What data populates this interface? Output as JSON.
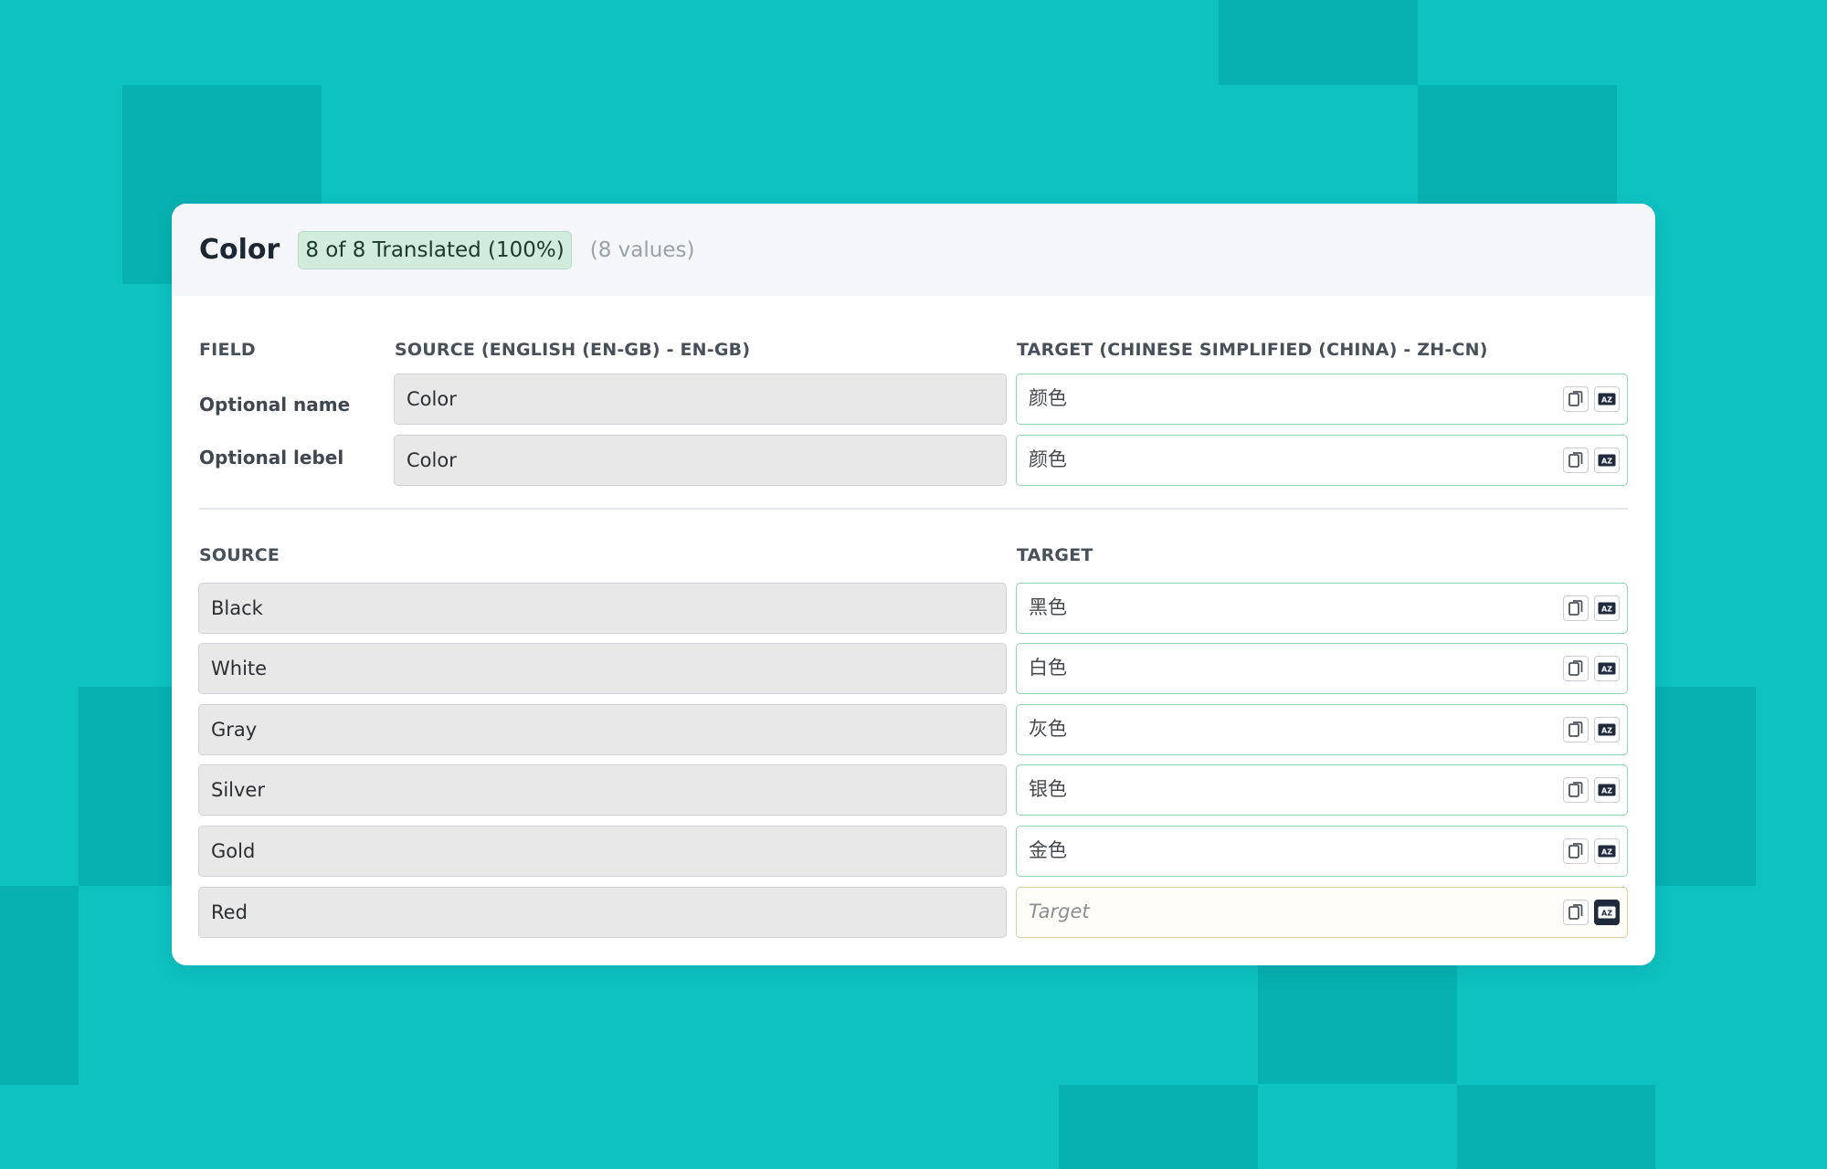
{
  "header": {
    "title": "Color",
    "badge": "8 of 8 Translated (100%)",
    "values_count": "(8 values)"
  },
  "fields_section": {
    "col_field": "FIELD",
    "col_source": "SOURCE (ENGLISH (EN-GB) - EN-GB)",
    "col_target": "TARGET (CHINESE SIMPLIFIED (CHINA) - ZH-CN)",
    "rows": [
      {
        "label": "Optional name",
        "source": "Color",
        "target": "颜色"
      },
      {
        "label": "Optional lebel",
        "source": "Color",
        "target": "颜色"
      }
    ]
  },
  "values_section": {
    "col_source": "SOURCE",
    "col_target": "TARGET",
    "rows": [
      {
        "source": "Black",
        "target": "黑色"
      },
      {
        "source": "White",
        "target": "白色"
      },
      {
        "source": "Gray",
        "target": "灰色"
      },
      {
        "source": "Silver",
        "target": "银色"
      },
      {
        "source": "Gold",
        "target": "金色"
      },
      {
        "source": "Red",
        "target": "",
        "placeholder": "Target"
      }
    ]
  },
  "icons": {
    "copy": "copy-icon",
    "translate": "auto-translate-icon"
  },
  "colors": {
    "background": "#0dc2c1",
    "badge_bg": "#d1ecdc",
    "translated_border": "#8fd2b4",
    "untranslated_border": "#dcc9a6",
    "translate_active": "#1f2b3c"
  }
}
